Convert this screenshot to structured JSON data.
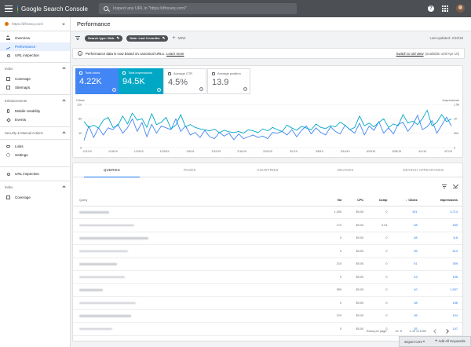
{
  "app": {
    "title": "Google Search Console"
  },
  "search": {
    "placeholder": "Inspect any URL in \"https://dfrsseq.com/\""
  },
  "sidebar": {
    "property": "https://dfrsseq.com/",
    "items": [
      {
        "label": "Overview",
        "icon": "home-icon"
      },
      {
        "label": "Performance",
        "icon": "trending-icon"
      },
      {
        "label": "URL inspection",
        "icon": "magnify-icon"
      }
    ],
    "sections": [
      {
        "label": "Index",
        "items": [
          "Coverage",
          "Sitemaps"
        ]
      },
      {
        "label": "Enhancements",
        "items": [
          "Mobile Usability",
          "Events"
        ]
      },
      {
        "label": "Security & Manual Actions",
        "items": []
      }
    ],
    "bottom_items": [
      "Links",
      "Settings"
    ],
    "extra_item": "URL inspection",
    "extra_section": {
      "label": "Index",
      "items": [
        "Coverage"
      ]
    }
  },
  "header": {
    "title": "Performance"
  },
  "filters": {
    "chips": [
      "Search type: Web",
      "Date: Last 3 months"
    ],
    "new_label": "NEW",
    "last_updated": "Last updated: 4/10/19"
  },
  "notice": {
    "text": "Performance data is now based on canonical URLs.",
    "link": "Learn more",
    "right_link": "Switch to old view",
    "right_text": "(available until Apr 10)"
  },
  "metrics": [
    {
      "label": "Total clicks",
      "value": "4.22K"
    },
    {
      "label": "Total impressions",
      "value": "94.5K"
    },
    {
      "label": "Average CTR",
      "value": "4.5%"
    },
    {
      "label": "Average position",
      "value": "13.9"
    }
  ],
  "chart_data": {
    "type": "line",
    "left_axis_label": "Clicks",
    "right_axis_label": "Impressions",
    "left_ticks": [
      "120",
      "80",
      "40",
      "0"
    ],
    "right_ticks": [
      "1.5K",
      "1K",
      "500",
      "0"
    ],
    "x_ticks": [
      "1/11/19",
      "1/16/19",
      "1/24/19",
      "1/29/19",
      "2/6/19",
      "2/12/19",
      "2/16/19",
      "2/24/19",
      "3/1/19",
      "3/8/19",
      "3/14/19",
      "3/20/19",
      "3/26/19",
      "4/1/19",
      "4/7/19"
    ],
    "series": [
      {
        "name": "Clicks",
        "color": "#4285f4",
        "axis": "left",
        "values": [
          20,
          60,
          28,
          55,
          35,
          55,
          50,
          65,
          40,
          55,
          80,
          45,
          70,
          30,
          65,
          40,
          60,
          55,
          50,
          80,
          45,
          60,
          35,
          42,
          28,
          48,
          30,
          25,
          42,
          32,
          40,
          22,
          38,
          25,
          30,
          35,
          28,
          32,
          25,
          42,
          40,
          45,
          35,
          50,
          30,
          48,
          60,
          38,
          55,
          42,
          35,
          58,
          45,
          38,
          62,
          50,
          40,
          68,
          35,
          60,
          48,
          72,
          40,
          55,
          38,
          65,
          70,
          45,
          62,
          90,
          50,
          58,
          75,
          40,
          62,
          85,
          60
        ]
      },
      {
        "name": "Impressions",
        "color": "#00a8c6",
        "axis": "right",
        "values": [
          900,
          700,
          780,
          680,
          950,
          1050,
          700,
          760,
          1100,
          820,
          1200,
          950,
          1000,
          700,
          1180,
          800,
          880,
          1050,
          650,
          780,
          1150,
          720,
          800,
          700,
          650,
          620,
          580,
          640,
          520,
          600,
          550,
          520,
          560,
          500,
          620,
          580,
          520,
          650,
          580,
          700,
          620,
          560,
          780,
          680,
          600,
          740,
          680,
          620,
          820,
          700,
          660,
          760,
          720,
          880,
          780,
          620,
          700,
          1100,
          760,
          850,
          720,
          880,
          1000,
          700,
          820,
          760,
          1150,
          850,
          920,
          800,
          1000,
          1300,
          750,
          880,
          1150,
          900,
          1000
        ]
      }
    ]
  },
  "table": {
    "tabs": [
      "QUERIES",
      "PAGES",
      "COUNTRIES",
      "DEVICES",
      "SEARCH APPEARANCE"
    ],
    "columns": [
      "Query",
      "Vol",
      "CPC",
      "Comp",
      "Clicks",
      "Impressions"
    ],
    "rows": [
      {
        "vol": "1,300",
        "cpc": "$0.00",
        "comp": "0",
        "clicks": "301",
        "impressions": "4,714"
      },
      {
        "vol": "170",
        "cpc": "$0.00",
        "comp": "0.01",
        "clicks": "68",
        "impressions": "539"
      },
      {
        "vol": "0",
        "cpc": "$0.00",
        "comp": "0",
        "clicks": "68",
        "impressions": "118"
      },
      {
        "vol": "0",
        "cpc": "$0.00",
        "comp": "0",
        "clicks": "55",
        "impressions": "513"
      },
      {
        "vol": "210",
        "cpc": "$0.00",
        "comp": "0",
        "clicks": "51",
        "impressions": "309"
      },
      {
        "vol": "0",
        "cpc": "$0.00",
        "comp": "0",
        "clicks": "43",
        "impressions": "156"
      },
      {
        "vol": "590",
        "cpc": "$0.00",
        "comp": "0",
        "clicks": "40",
        "impressions": "1,097"
      },
      {
        "vol": "0",
        "cpc": "$0.00",
        "comp": "0",
        "clicks": "38",
        "impressions": "156"
      },
      {
        "vol": "210",
        "cpc": "$0.00",
        "comp": "0",
        "clicks": "36",
        "impressions": "104"
      },
      {
        "vol": "0",
        "cpc": "$0.00",
        "comp": "0",
        "clicks": "35",
        "impressions": "147"
      }
    ],
    "rows_per_page_label": "Rows per page:",
    "rows_per_page": "10",
    "range": "1-10 of 1000"
  },
  "footer": {
    "export": "Export CSV",
    "add": "Add All Keywords"
  }
}
